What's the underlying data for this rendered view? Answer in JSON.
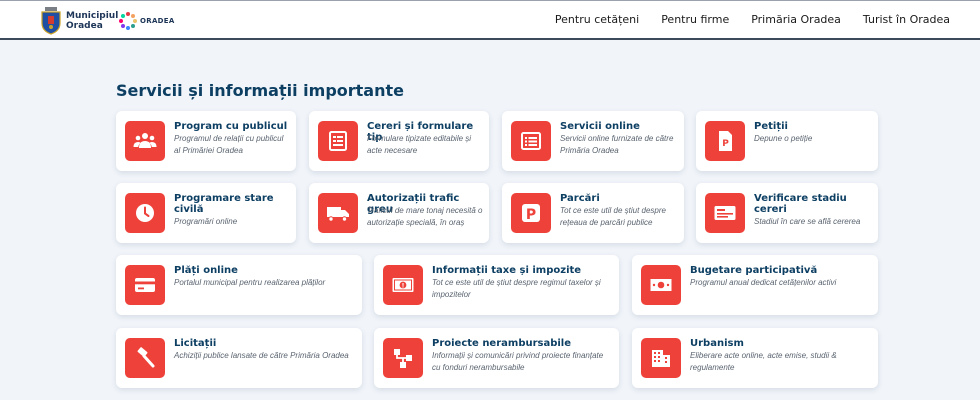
{
  "header": {
    "logo_line1": "Municipiul",
    "logo_line2": "Oradea",
    "brand": "ORADEA"
  },
  "nav": [
    {
      "label": "Pentru cetățeni"
    },
    {
      "label": "Pentru firme"
    },
    {
      "label": "Primăria Oradea"
    },
    {
      "label": "Turist în Oradea"
    }
  ],
  "section": {
    "title": "Servicii și informații importante"
  },
  "services": [
    {
      "title": "Program cu publicul",
      "description": "Programul de relații cu publicul al Primăriei Oradea",
      "icon": "people-icon"
    },
    {
      "title": "Cereri și formulare tip",
      "description": "Formulare tipizate editabile și acte necesare",
      "icon": "form-icon"
    },
    {
      "title": "Servicii online",
      "description": "Servicii online furnizate de către Primăria Oradea",
      "icon": "list-icon"
    },
    {
      "title": "Petiții",
      "description": "Depune o petiție",
      "icon": "document-icon"
    },
    {
      "title": "Programare stare civilă",
      "description": "Programări online",
      "icon": "clock-icon"
    },
    {
      "title": "Autorizații trafic greu",
      "description": "Traficul de mare tonaj necesită o autorizație specială, în oraș",
      "icon": "truck-icon"
    },
    {
      "title": "Parcări",
      "description": "Tot ce este util de știut despre rețeaua de parcări publice",
      "icon": "parking-icon"
    },
    {
      "title": "Verificare stadiu cereri",
      "description": "Stadiul în care se află cererea",
      "icon": "id-card-icon"
    },
    {
      "title": "Plăți online",
      "description": "Portalul municipal pentru realizarea plăților",
      "icon": "credit-card-icon"
    },
    {
      "title": "Informații taxe și impozite",
      "description": "Tot ce este util de știut despre regimul taxelor și impozitelor",
      "icon": "money-icon"
    },
    {
      "title": "Bugetare participativă",
      "description": "Programul anual dedicat cetățenilor activi",
      "icon": "banknote-icon"
    },
    {
      "title": "Licitații",
      "description": "Achiziții publice lansate de către Primăria Oradea",
      "icon": "gavel-icon"
    },
    {
      "title": "Proiecte nerambursabile",
      "description": "Informații și comunicări privind proiecte finanțate cu fonduri nerambursabile",
      "icon": "network-icon"
    },
    {
      "title": "Urbanism",
      "description": "Eliberare acte online, acte emise, studii & regulamente",
      "icon": "building-icon"
    }
  ],
  "colors": {
    "accent": "#ee4139",
    "title": "#0d3f63",
    "background": "#f1f5fa"
  }
}
